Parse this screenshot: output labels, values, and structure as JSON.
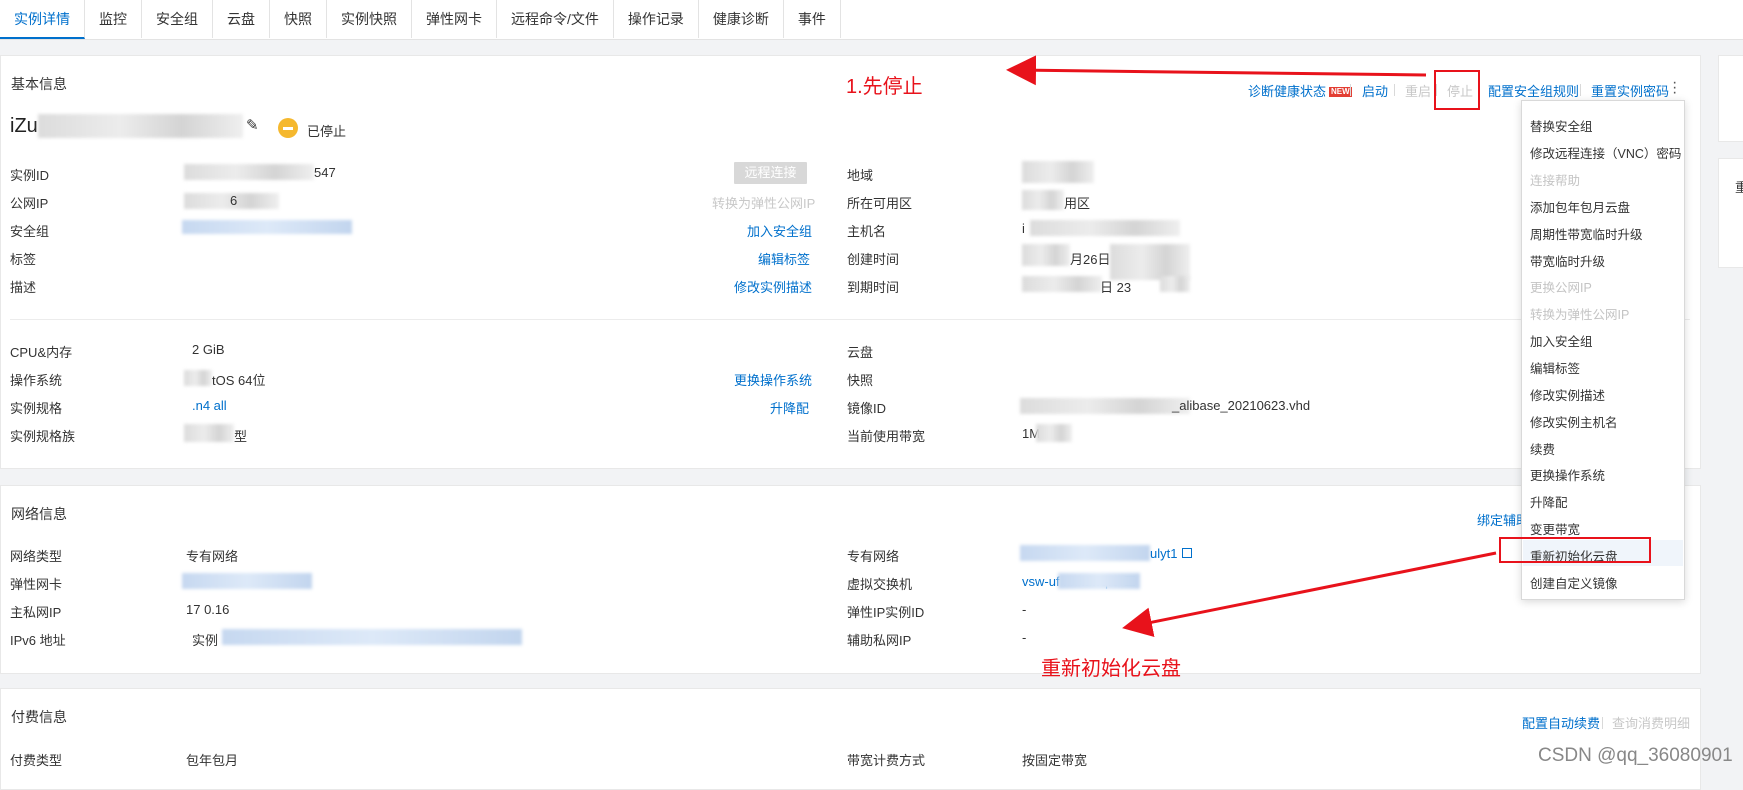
{
  "tabs": [
    "实例详情",
    "监控",
    "安全组",
    "云盘",
    "快照",
    "实例快照",
    "弹性网卡",
    "远程命令/文件",
    "操作记录",
    "健康诊断",
    "事件"
  ],
  "basic": {
    "title": "基本信息",
    "instance_name_prefix": "iZu",
    "status": "已停止",
    "actions": {
      "diagnose": "诊断健康状态",
      "new_badge": "NEW",
      "start": "启动",
      "restart": "重启",
      "stop": "停止",
      "config_sg_rules": "配置安全组规则",
      "reset_password": "重置实例密码"
    },
    "left_rows": [
      {
        "label": "实例ID",
        "value": "547"
      },
      {
        "label": "公网IP",
        "value": "6"
      },
      {
        "label": "安全组",
        "value": ""
      },
      {
        "label": "标签",
        "value": ""
      },
      {
        "label": "描述",
        "value": ""
      }
    ],
    "left_links": {
      "remote_connect": "远程连接",
      "convert_eip": "转换为弹性公网IP",
      "join_sg": "加入安全组",
      "edit_tags": "编辑标签",
      "edit_desc": "修改实例描述"
    },
    "right_rows": [
      {
        "label": "地域",
        "value": ""
      },
      {
        "label": "所在可用区",
        "value": "用区"
      },
      {
        "label": "主机名",
        "value": "i"
      },
      {
        "label": "创建时间",
        "value": "月26日"
      },
      {
        "label": "到期时间",
        "value": "日 23"
      }
    ],
    "left_rows2": [
      {
        "label": "CPU&内存",
        "value": "2 GiB"
      },
      {
        "label": "操作系统",
        "value": "tOS 64位"
      },
      {
        "label": "实例规格",
        "value": ".n4 all"
      },
      {
        "label": "实例规格族",
        "value": "型"
      }
    ],
    "left_links2": {
      "change_os": "更换操作系统",
      "upgrade": "升降配"
    },
    "right_rows2": [
      {
        "label": "云盘",
        "value": ""
      },
      {
        "label": "快照",
        "value": ""
      },
      {
        "label": "镜像ID",
        "value": "_alibase_20210623.vhd"
      },
      {
        "label": "当前使用带宽",
        "value": "1M"
      }
    ]
  },
  "network": {
    "title": "网络信息",
    "bind_link": "绑定辅助",
    "left_rows": [
      {
        "label": "网络类型",
        "value": "专有网络"
      },
      {
        "label": "弹性网卡",
        "value": ""
      },
      {
        "label": "主私网IP",
        "value": "17 0.16"
      },
      {
        "label": "IPv6 地址",
        "value": "实例"
      }
    ],
    "right_rows": [
      {
        "label": "专有网络",
        "value": "ulyt1"
      },
      {
        "label": "虚拟交换机",
        "value": "vsw-uf nnkdwqr9"
      },
      {
        "label": "弹性IP实例ID",
        "value": "-"
      },
      {
        "label": "辅助私网IP",
        "value": "-"
      }
    ]
  },
  "billing": {
    "title": "付费信息",
    "auto_renew": "配置自动续费",
    "query_detail": "查询消费明细",
    "left_rows": [
      {
        "label": "付费类型",
        "value": "包年包月"
      }
    ],
    "right_rows": [
      {
        "label": "带宽计费方式",
        "value": "按固定带宽"
      }
    ]
  },
  "dropdown": [
    {
      "label": "替换安全组",
      "disabled": false
    },
    {
      "label": "修改远程连接（VNC）密码",
      "disabled": false
    },
    {
      "label": "连接帮助",
      "disabled": true
    },
    {
      "label": "添加包年包月云盘",
      "disabled": false
    },
    {
      "label": "周期性带宽临时升级",
      "disabled": false
    },
    {
      "label": "带宽临时升级",
      "disabled": false
    },
    {
      "label": "更换公网IP",
      "disabled": true
    },
    {
      "label": "转换为弹性公网IP",
      "disabled": true
    },
    {
      "label": "加入安全组",
      "disabled": false
    },
    {
      "label": "编辑标签",
      "disabled": false
    },
    {
      "label": "修改实例描述",
      "disabled": false
    },
    {
      "label": "修改实例主机名",
      "disabled": false
    },
    {
      "label": "续费",
      "disabled": false
    },
    {
      "label": "更换操作系统",
      "disabled": false
    },
    {
      "label": "升降配",
      "disabled": false
    },
    {
      "label": "变更带宽",
      "disabled": false
    },
    {
      "label": "重新初始化云盘",
      "disabled": false
    },
    {
      "label": "创建自定义镜像",
      "disabled": false
    }
  ],
  "annotations": {
    "step1": "1.先停止",
    "reinit": "重新初始化云盘"
  },
  "side_card_char": "重",
  "watermark": "CSDN @qq_36080901",
  "colors": {
    "link": "#0070cc",
    "annotation": "#e8121b",
    "status_stopped": "#f5b82e",
    "new_badge": "#e33e33"
  }
}
